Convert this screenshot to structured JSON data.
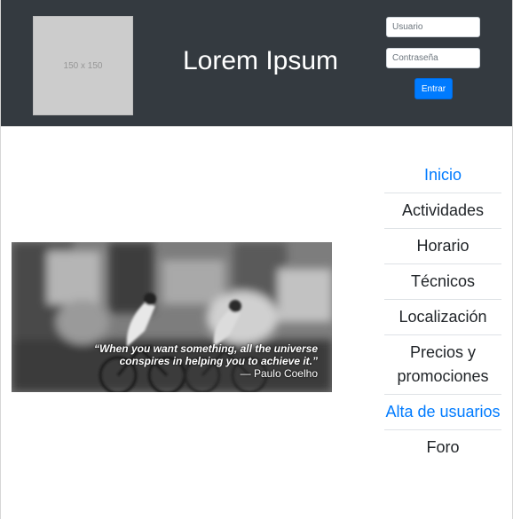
{
  "header": {
    "logo_placeholder": "150 x 150",
    "site_title": "Lorem Ipsum",
    "login": {
      "user_placeholder": "Usuario",
      "password_placeholder": "Contraseña",
      "submit_label": "Entrar"
    }
  },
  "hero": {
    "quote_line1": "“When you want something, all the universe",
    "quote_line2": "conspires in helping you to achieve it.”",
    "author": "— Paulo Coelho"
  },
  "nav": {
    "items": [
      {
        "label": "Inicio",
        "style": "link"
      },
      {
        "label": "Actividades",
        "style": "plain"
      },
      {
        "label": "Horario",
        "style": "plain"
      },
      {
        "label": "Técnicos",
        "style": "plain"
      },
      {
        "label": "Localización",
        "style": "plain"
      },
      {
        "label": "Precios y promociones",
        "style": "plain"
      },
      {
        "label": "Alta de usuarios",
        "style": "link"
      },
      {
        "label": "Foro",
        "style": "plain"
      }
    ]
  },
  "colors": {
    "header_bg": "#343a40",
    "link": "#007bff",
    "button": "#007bff"
  }
}
